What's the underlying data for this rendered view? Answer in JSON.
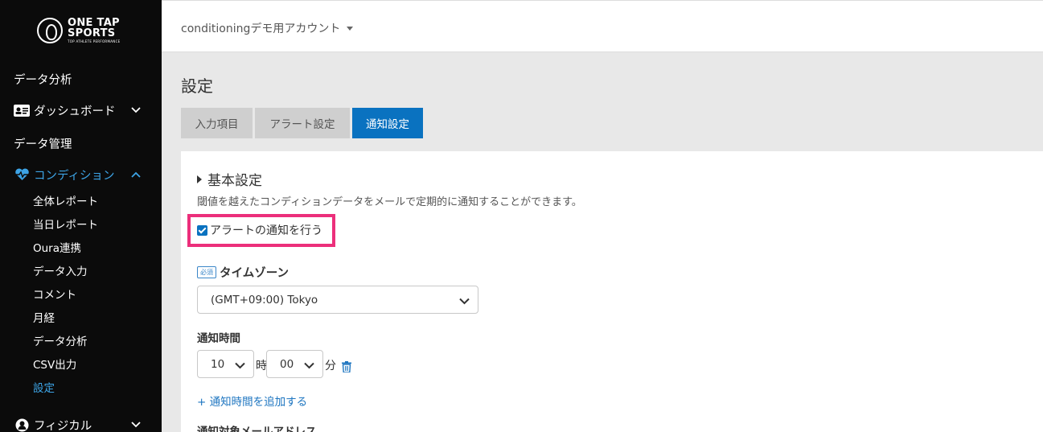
{
  "sidebar": {
    "logo": {
      "line1": "ONE TAP",
      "line2": "SPORTS",
      "tagline": "TOP ATHLETE PERFORMANCE"
    },
    "top_items": [
      "データ分析"
    ],
    "dashboard": "ダッシュボード",
    "data_management": "データ管理",
    "condition": "コンディション",
    "sub_items": [
      "全体レポート",
      "当日レポート",
      "Oura連携",
      "データ入力",
      "コメント",
      "月経",
      "データ分析",
      "CSV出力",
      "設定"
    ],
    "physical": "フィジカル",
    "active_color": "#3da4e6"
  },
  "header": {
    "account": "conditioningデモ用アカウント"
  },
  "page": {
    "title": "設定",
    "tabs": [
      "入力項目",
      "アラート設定",
      "通知設定"
    ],
    "active_tab": "通知設定"
  },
  "basic": {
    "title": "基本設定",
    "description": "閾値を越えたコンディションデータをメールで定期的に通知することができます。",
    "alert_checkbox_label": "アラートの通知を行う",
    "alert_checked": true,
    "required_badge": "必須",
    "timezone_label": "タイムゾーン",
    "timezone_value": "(GMT+09:00) Tokyo",
    "notify_time_label": "通知時間",
    "hour_value": "10",
    "hour_unit": "時",
    "minute_value": "00",
    "minute_unit": "分",
    "add_time_link": "+ 通知時間を追加する",
    "email_label": "通知対象メールアドレス"
  },
  "colors": {
    "accent": "#0a72c0",
    "highlight": "#ec2f7b",
    "sidebar_bg": "#0b0b0b"
  }
}
